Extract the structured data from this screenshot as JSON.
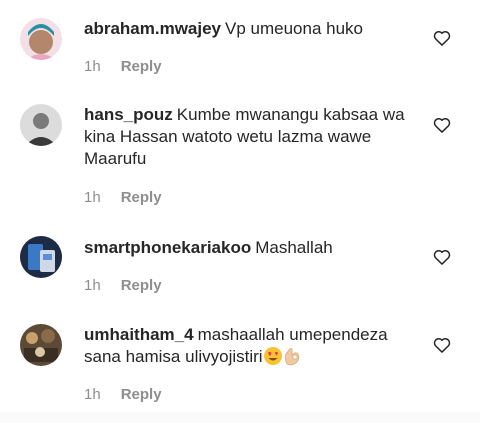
{
  "comments": [
    {
      "username": "abraham.mwajey",
      "text": "Vp umeuona huko",
      "time": "1h",
      "reply": "Reply",
      "emojis": []
    },
    {
      "username": "hans_pouz",
      "text": "Kumbe mwanangu kabsaa wa kina Hassan watoto wetu lazma wawe Maarufu",
      "time": "1h",
      "reply": "Reply",
      "emojis": []
    },
    {
      "username": "smartphonekariakoo",
      "text": "Mashallah",
      "time": "1h",
      "reply": "Reply",
      "emojis": []
    },
    {
      "username": "umhaitham_4",
      "text": "mashaallah umependeza sana hamisa ulivyojistiri",
      "time": "1h",
      "reply": "Reply",
      "emojis": [
        "heart-eyes-emoji",
        "ok-hand-emoji"
      ]
    }
  ],
  "icons": {
    "like": "heart-outline-icon"
  },
  "colors": {
    "text": "#262626",
    "meta": "#8e8e8e"
  }
}
